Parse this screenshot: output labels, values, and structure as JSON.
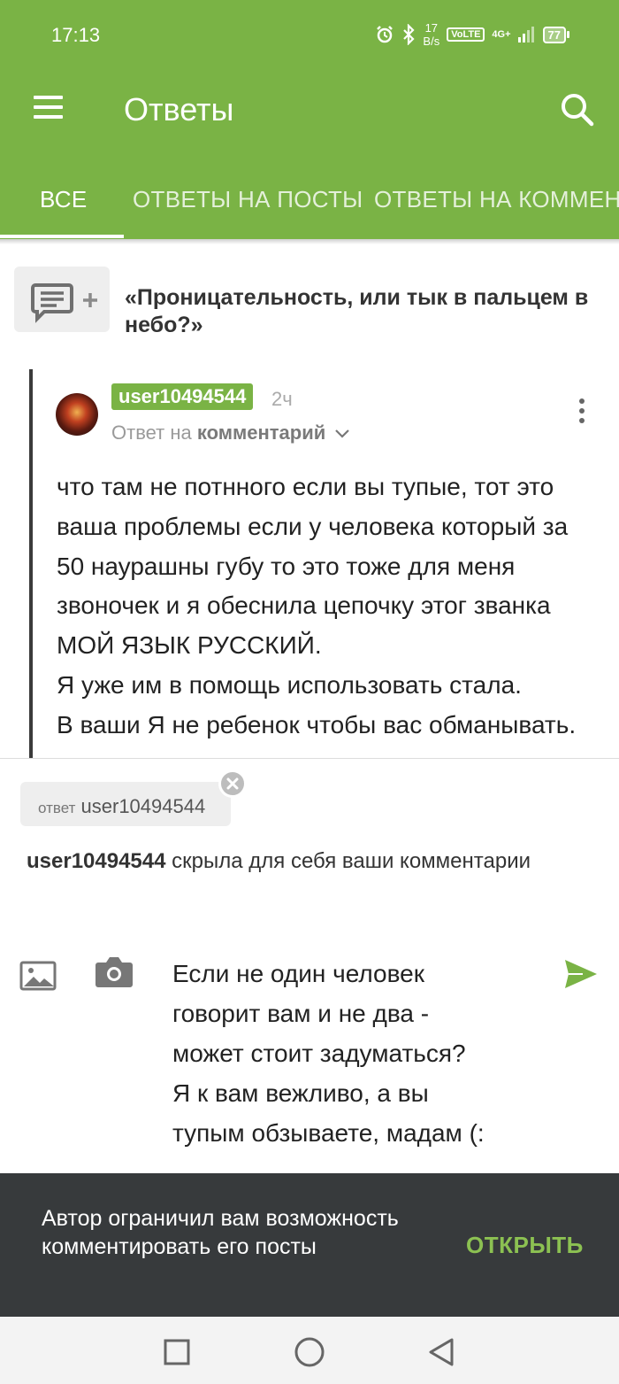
{
  "status_bar": {
    "time": "17:13",
    "speed_value": "17",
    "speed_unit": "B/s",
    "volte": "VoLTE",
    "network": "4G+",
    "battery": "77"
  },
  "header": {
    "title": "Ответы"
  },
  "tabs": [
    {
      "label": "ВСЕ"
    },
    {
      "label": "ОТВЕТЫ НА ПОСТЫ"
    },
    {
      "label": "ОТВЕТЫ НА КОММЕНТАРИИ"
    }
  ],
  "post": {
    "title": "«Проницательность, или тык в пальцем в небо?»"
  },
  "comment": {
    "username": "user10494544",
    "time_ago": "2ч",
    "reply_prefix": "Ответ на",
    "reply_target": "комментарий",
    "body": "что там не потнного если вы тупые, тот это ваша проблемы если у человека который за 50 наурашны губу то это тоже для меня звоночек и я обеснила цепочку этог званка МОЙ ЯЗЫК РУССКИЙ.\nЯ уже им в помощь использовать стала.\nВ ваши Я не ребенок чтобы вас обманывать."
  },
  "reply": {
    "chip_prefix": "ответ",
    "chip_user": "user10494544",
    "notice_user": "user10494544",
    "notice_text": " скрыла для себя ваши комментарии",
    "input_value": "Если не один человек\nговорит вам и не два -\nможет стоит задуматься?\nЯ к вам вежливо, а вы\nтупым обзываете, мадам (:"
  },
  "banner": {
    "text": "Автор ограничил вам возможность комментировать его посты",
    "action": "ОТКРЫТЬ"
  },
  "colors": {
    "brand_green": "#7ab345",
    "banner_bg": "#373a3c",
    "banner_action": "#8cc152"
  },
  "icons": {
    "menu": "hamburger-icon",
    "search": "search-icon",
    "post": "comment-add-icon",
    "more": "more-vertical-icon",
    "close": "close-icon",
    "image": "image-icon",
    "camera": "camera-icon",
    "send": "send-icon"
  }
}
